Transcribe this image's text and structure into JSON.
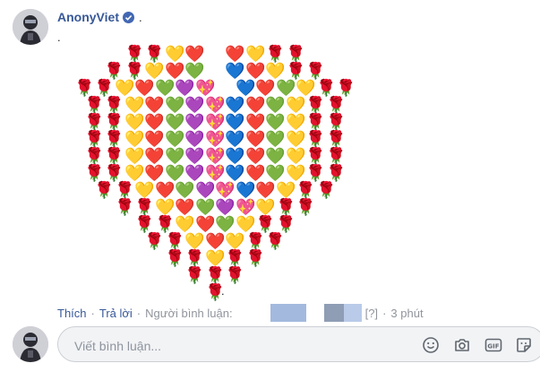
{
  "post": {
    "author_name": "AnonyViet",
    "author_trailing": ".",
    "body_line": ".",
    "art_tail": ".",
    "heart_rows": [
      "🌹🌹💛❤️ ❤️💛🌹🌹",
      "🌹🌹💛❤️💚 💙❤️💛🌹🌹",
      "🌹🌹💛❤️💚💜💖 💙❤️💚💛🌹🌹",
      "🌹🌹💛❤️💚💜💖💙❤️💚💛🌹🌹",
      "🌹🌹💛❤️💚💜💖💙❤️💚💛🌹🌹",
      "🌹🌹💛❤️💚💜💖💙❤️💚💛🌹🌹",
      "🌹🌹💛❤️💚💜💖💙❤️💚💛🌹🌹",
      "🌹🌹💛❤️💚💜💖💙❤️💚💛🌹🌹",
      "🌹🌹💛❤️💚💜💖💙❤️💛🌹🌹",
      "🌹🌹💛❤️💚💜💖💛🌹🌹",
      "🌹🌹💛❤️💚💛🌹🌹",
      "🌹🌹💛❤️💛🌹🌹",
      "🌹🌹💛🌹🌹",
      "🌹🌹🌹",
      "🌹"
    ]
  },
  "actions": {
    "like": "Thích",
    "reply": "Trả lời",
    "commenter_label": "Người bình luận:",
    "unknown": "[?]",
    "time": "3 phút",
    "dot": "·"
  },
  "comment_box": {
    "placeholder": "Viết bình luận..."
  },
  "icons": {
    "verified": "verified-badge-icon",
    "emoji": "smiley-icon",
    "camera": "camera-icon",
    "gif": "gif-icon",
    "sticker": "sticker-icon"
  },
  "colors": {
    "link": "#385898",
    "muted": "#90949c",
    "input_bg": "#f2f3f5"
  }
}
